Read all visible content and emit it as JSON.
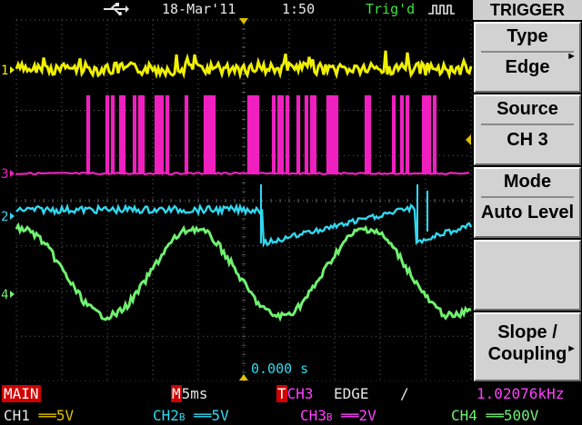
{
  "topbar": {
    "usb_icon": "usb-icon",
    "date": "18-Mar'11",
    "time": "1:50",
    "trig_status": "Trig'd",
    "trig_icon": "trigger-edge-icon"
  },
  "menu": {
    "title": "TRIGGER",
    "buttons": [
      {
        "label": "Type",
        "value": "Edge"
      },
      {
        "label": "Source",
        "value": "CH 3"
      },
      {
        "label": "Mode",
        "value": "Auto Level"
      },
      {
        "label": "",
        "value": ""
      },
      {
        "label": "Slope /",
        "value": "Coupling"
      }
    ]
  },
  "readouts": {
    "trigger_position": "0.000 s"
  },
  "markers": {
    "ch1": "1",
    "ch2": "2",
    "ch3": "3",
    "ch4": "4"
  },
  "status": {
    "main_label": "MAIN",
    "timebase_prefix": "M",
    "timebase": "5ms",
    "trig_source_prefix": "T",
    "trig_source": "CH3",
    "trig_type": "EDGE",
    "slope_symbol": "/",
    "frequency": "1.02076kHz",
    "ch1_label": "CH1",
    "ch1_coupling": "══",
    "ch1_scale": "5V",
    "ch2_label": "CH2",
    "ch2_bw": "B",
    "ch2_coupling": "══",
    "ch2_scale": "5V",
    "ch3_label": "CH3",
    "ch3_bw": "B",
    "ch3_coupling": "══",
    "ch3_scale": "2V",
    "ch4_label": "CH4",
    "ch4_coupling": "══",
    "ch4_scale": "500V"
  },
  "colors": {
    "ch1": "#f0f000",
    "ch2": "#30d8f0",
    "ch3": "#f020c0",
    "ch4": "#70f070",
    "grid": "#606060",
    "accent_yellow": "#e0c000",
    "accent_red": "#d00000",
    "accent_magenta": "#ff40ff"
  }
}
